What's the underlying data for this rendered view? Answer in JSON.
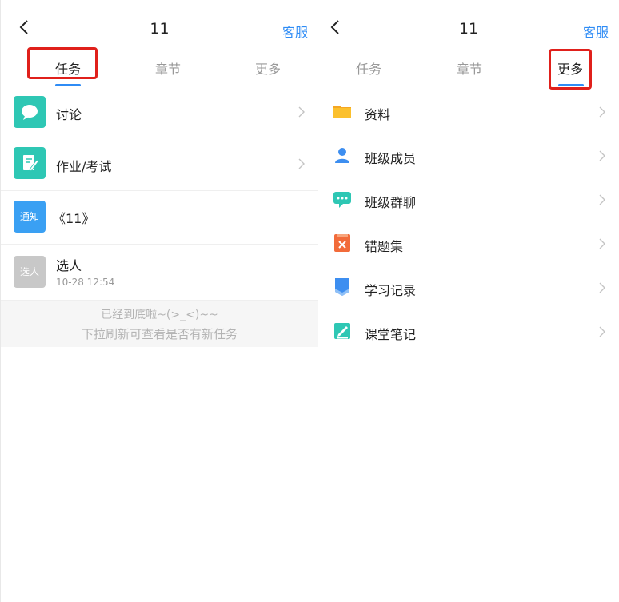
{
  "left": {
    "header": {
      "title": "11",
      "service": "客服"
    },
    "tabs": [
      "任务",
      "章节",
      "更多"
    ],
    "items": [
      {
        "label": "讨论"
      },
      {
        "label": "作业/考试"
      },
      {
        "label": "《11》",
        "badge": "通知"
      },
      {
        "label": "选人",
        "badge": "选人",
        "time": "10-28 12:54"
      }
    ],
    "footer": {
      "line1": "已经到底啦~(>_<)~~",
      "line2": "下拉刷新可查看是否有新任务"
    }
  },
  "right": {
    "header": {
      "title": "11",
      "service": "客服"
    },
    "tabs": [
      "任务",
      "章节",
      "更多"
    ],
    "items": [
      {
        "label": "资料"
      },
      {
        "label": "班级成员"
      },
      {
        "label": "班级群聊"
      },
      {
        "label": "错题集"
      },
      {
        "label": "学习记录"
      },
      {
        "label": "课堂笔记"
      }
    ]
  },
  "colors": {
    "accent": "#2f8cf5",
    "highlight_box": "#e0201b",
    "teal": "#2ec7b4",
    "notice_blue": "#3aa0f3",
    "gray_badge": "#c8c8c8"
  }
}
